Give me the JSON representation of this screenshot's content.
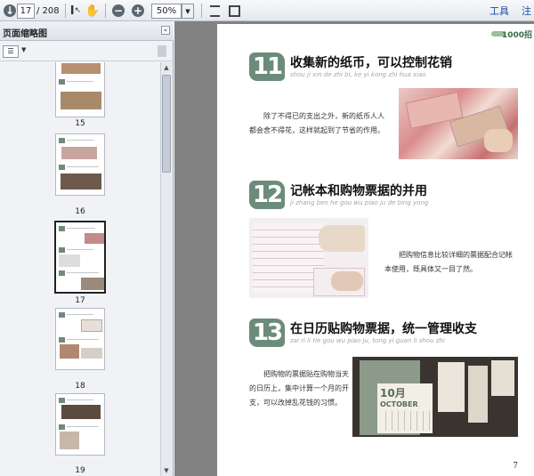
{
  "toolbar": {
    "page_current": "17",
    "page_total": "/ 208",
    "zoom_value": "50%",
    "zoom_out": "−",
    "zoom_in": "+",
    "menu_tools": "工具",
    "menu_comment": "注"
  },
  "sidebar": {
    "title": "页面缩略图",
    "collapse": "«",
    "thumbnails": [
      {
        "label": "15"
      },
      {
        "label": "16"
      },
      {
        "label": "17"
      },
      {
        "label": "18"
      },
      {
        "label": "19"
      }
    ]
  },
  "page": {
    "brand": "1000招",
    "number": "7",
    "sections": [
      {
        "num": "11",
        "title": "收集新的纸币，可以控制花销",
        "pinyin": "shou ji xin de zhi bi, ke yi kong zhi hua xiao",
        "body": "除了不得已的支出之外，新的纸币人人都会舍不得花，这样就起到了节省的作用。"
      },
      {
        "num": "12",
        "title": "记帐本和购物票据的并用",
        "pinyin": "ji zhang ben he gou wu piao ju de bing yong",
        "body": "把购物信息比较详细的票据配合记帐本使用，既具体又一目了然。"
      },
      {
        "num": "13",
        "title": "在日历贴购物票据，统一管理收支",
        "pinyin": "zai ri li tie gou wu piao ju, tong yi guan li shou zhi",
        "body": "把购物的票据贴在购物当天的日历上，集中计算一个月的开支，可以改掉乱花钱的习惯。"
      }
    ],
    "calendar_month": "10月",
    "calendar_name": "OCTOBER"
  }
}
